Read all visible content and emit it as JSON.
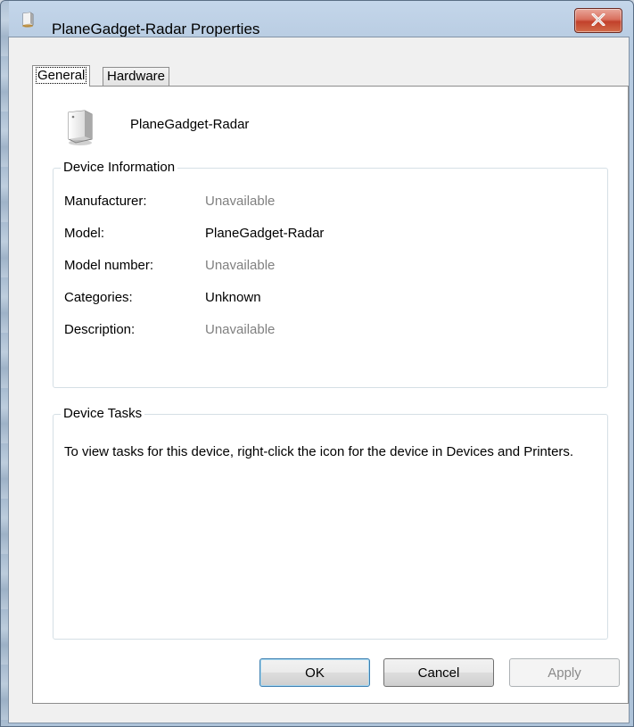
{
  "window": {
    "title": "PlaneGadget-Radar Properties"
  },
  "tabs": [
    {
      "label": "General",
      "selected": true
    },
    {
      "label": "Hardware",
      "selected": false
    }
  ],
  "device": {
    "name": "PlaneGadget-Radar",
    "icon": "device-tower-icon"
  },
  "device_information": {
    "legend": "Device Information",
    "rows": [
      {
        "label": "Manufacturer:",
        "value": "Unavailable",
        "unavailable": true
      },
      {
        "label": "Model:",
        "value": "PlaneGadget-Radar",
        "unavailable": false
      },
      {
        "label": "Model number:",
        "value": "Unavailable",
        "unavailable": true
      },
      {
        "label": "Categories:",
        "value": "Unknown",
        "unavailable": false
      },
      {
        "label": "Description:",
        "value": "Unavailable",
        "unavailable": true
      }
    ]
  },
  "device_tasks": {
    "legend": "Device Tasks",
    "text": "To view tasks for this device, right-click the icon for the device in Devices and Printers."
  },
  "buttons": {
    "ok": "OK",
    "cancel": "Cancel",
    "apply": "Apply"
  },
  "colors": {
    "unavailable_text": "#808080",
    "close_button": "#c2412b",
    "default_button_border": "#3c7fb1"
  }
}
